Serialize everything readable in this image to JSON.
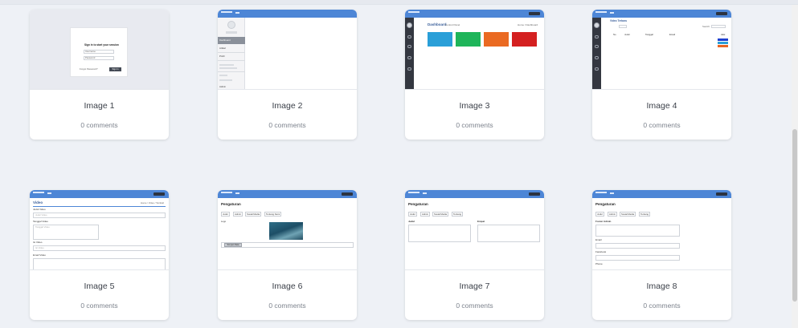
{
  "cards": [
    {
      "title": "Image 1",
      "comments": "0 comments"
    },
    {
      "title": "Image 2",
      "comments": "0 comments"
    },
    {
      "title": "Image 3",
      "comments": "0 comments"
    },
    {
      "title": "Image 4",
      "comments": "0 comments"
    },
    {
      "title": "Image 5",
      "comments": "0 comments"
    },
    {
      "title": "Image 6",
      "comments": "0 comments"
    },
    {
      "title": "Image 7",
      "comments": "0 comments"
    },
    {
      "title": "Image 8",
      "comments": "0 comments"
    }
  ],
  "thumbs": {
    "t1": {
      "heading": "Sign in to start your session",
      "user_ph": "Username",
      "pass_ph": "Password",
      "forgot": "Forgot Password?",
      "button": "Sign In"
    },
    "t2": {
      "items": [
        "Dashboard",
        "Artikel",
        "Profil",
        "Admin"
      ]
    },
    "t3": {
      "title": "Dashboard",
      "sub": "Control Panel",
      "crumb": "Home / Dashboard",
      "tiles": [
        "#2a9fd8",
        "#1fb55a",
        "#ea6a22",
        "#d42020"
      ]
    },
    "t4": {
      "title": "Video Terbaru",
      "search": "Search:",
      "cols": [
        "No",
        "Judul",
        "Tanggal",
        "Email",
        "Aksi"
      ],
      "btn_colors": [
        "#1e3fd0",
        "#2a9fd8",
        "#e86422"
      ]
    },
    "t5": {
      "title": "Video",
      "crumb": "Home / Video / Tambah",
      "fields": [
        "Judul Video",
        "Tanggal Video",
        "Isi Video",
        "Email Video"
      ],
      "ph": [
        "Judul Video",
        "Tanggal Video",
        "Isi Video"
      ]
    },
    "t6": {
      "title": "Pengaturan",
      "tabs": [
        "Judul",
        "Admin",
        "Sosial Media",
        "Tentang Kami"
      ],
      "label": "Logo",
      "button": "Simpan Data"
    },
    "t7": {
      "title": "Pengaturan",
      "tabs": [
        "Judul",
        "Admin",
        "Sosial Media",
        "Tentang"
      ],
      "col1": "Judul",
      "col2": "Empat"
    },
    "t8": {
      "title": "Pengaturan",
      "tabs": [
        "Judul",
        "Admin",
        "Sosial Media",
        "Tentang"
      ],
      "fields": [
        "Footer Admin",
        "Email",
        "Facebook",
        "Phone"
      ]
    }
  }
}
